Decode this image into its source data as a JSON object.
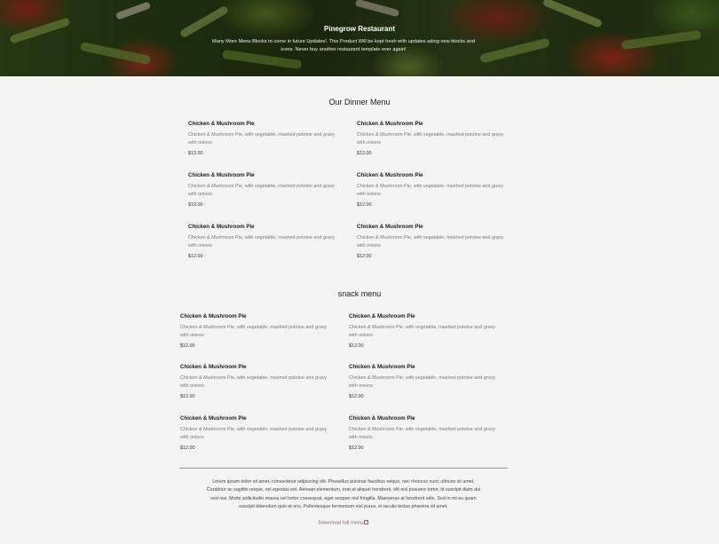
{
  "hero": {
    "title": "Pinegrow Restaurant",
    "text": "Many More Menu Blocks to come in future Updates!. This Product Will be kept fresh with updates ading new blocks and icons. Never buy another restaurant template ever again!"
  },
  "dinner_menu": {
    "title": "Our Dinner Menu",
    "items": [
      {
        "name": "Chicken & Mushroom Pie",
        "description": "Chicken & Mushroom Pie, with vegetable, mashed pototoe and gravy with onions",
        "price": "$12.00"
      },
      {
        "name": "Chicken & Mushroom Pie",
        "description": "Chicken & Mushroom Pie, with vegetable, mashed pototoe and gravy with onions",
        "price": "$12.00"
      },
      {
        "name": "Chicken & Mushroom Pie",
        "description": "Chicken & Mushroom Pie, with vegetable, mashed pototoe and gravy with onions",
        "price": "$12.00"
      },
      {
        "name": "Chicken & Mushroom Pie",
        "description": "Chicken & Mushroom Pie, with vegetable, mashed pototoe and gravy with onions",
        "price": "$12.00"
      },
      {
        "name": "Chicken & Mushroom Pie",
        "description": "Chicken & Mushroom Pie, with vegetable, mashed pototoe and gravy with onions",
        "price": "$12.00"
      },
      {
        "name": "Chicken & Mushroom Pie",
        "description": "Chicken & Mushroom Pie, with vegetable, mashed pototoe and gravy with onions",
        "price": "$12.00"
      }
    ]
  },
  "snack_menu": {
    "title": "snack menu",
    "items": [
      {
        "name": "Chicken & Mushroom Pie",
        "description": "Chicken & Mushroom Pie, with vegetable, mashed pototoe and gravy with onions",
        "price": "$12.00"
      },
      {
        "name": "Chicken & Mushroom Pie",
        "description": "Chicken & Mushroom Pie, with vegetable, mashed pototoe and gravy with onions",
        "price": "$12.00"
      },
      {
        "name": "Chicken & Mushroom Pie",
        "description": "Chicken & Mushroom Pie, with vegetable, mashed pototoe and gravy with onions",
        "price": "$12.00"
      },
      {
        "name": "Chicken & Mushroom Pie",
        "description": "Chicken & Mushroom Pie, with vegetable, mashed pototoe and gravy with onions",
        "price": "$12.00"
      },
      {
        "name": "Chicken & Mushroom Pie",
        "description": "Chicken & Mushroom Pie, with vegetable, mashed pototoe and gravy with onions",
        "price": "$12.00"
      },
      {
        "name": "Chicken & Mushroom Pie",
        "description": "Chicken & Mushroom Pie, with vegetable, mashed pototoe and gravy with onions",
        "price": "$12.00"
      }
    ]
  },
  "footer": {
    "text": "Lorem ipsum dolor sit amet, consectetur adipiscing elit. Phasellus pulvinar faucibus neque, nec rhoncus nunc ultrices sit amet. Curabitur ac sagittis neque, vel egestas est. Aenean elementum, erat at aliquet hendrerit, elit nisl posuere tortor, id suscipit diam dui sed nisi. Morbi sollicitudin massa vel tortor consequat, eget semper nisl fringilla. Maecenas at hendrerit odio. Sed in mi eu quam suscipit bibendum quis at orci. Pellentesque fermentum nisl purus, et iaculis lectus pharetra sit amet.",
    "link_label": "Download full menu",
    "link_icon": "external-link-icon"
  }
}
